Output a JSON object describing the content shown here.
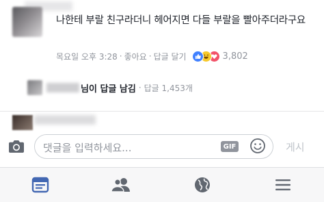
{
  "comment": {
    "text": "나한테 부랄 친구라더니 헤어지면 다들 부랄을 빨아주더라구요",
    "time": "목요일 오후 3:28",
    "like_label": "좋아요",
    "reply_label": "답글 달기",
    "reaction_count": "3,802",
    "reactions": [
      "like-icon",
      "haha-icon",
      "love-icon"
    ]
  },
  "reply_summary": {
    "label": "님이 답글 남김",
    "time": "답글 1,453개"
  },
  "composer": {
    "placeholder": "댓글을 입력하세요...",
    "gif_label": "GIF",
    "post_label": "게시"
  },
  "tabbar": {
    "tabs": [
      "news-feed-icon",
      "friends-icon",
      "globe-icon",
      "menu-icon"
    ],
    "active_index": 0
  },
  "colors": {
    "active_tab": "#4267b2",
    "inactive_tab": "#616770",
    "meta_text": "#90949c",
    "like": "#4080ff",
    "love": "#f25268",
    "haha": "#f7c92b"
  }
}
